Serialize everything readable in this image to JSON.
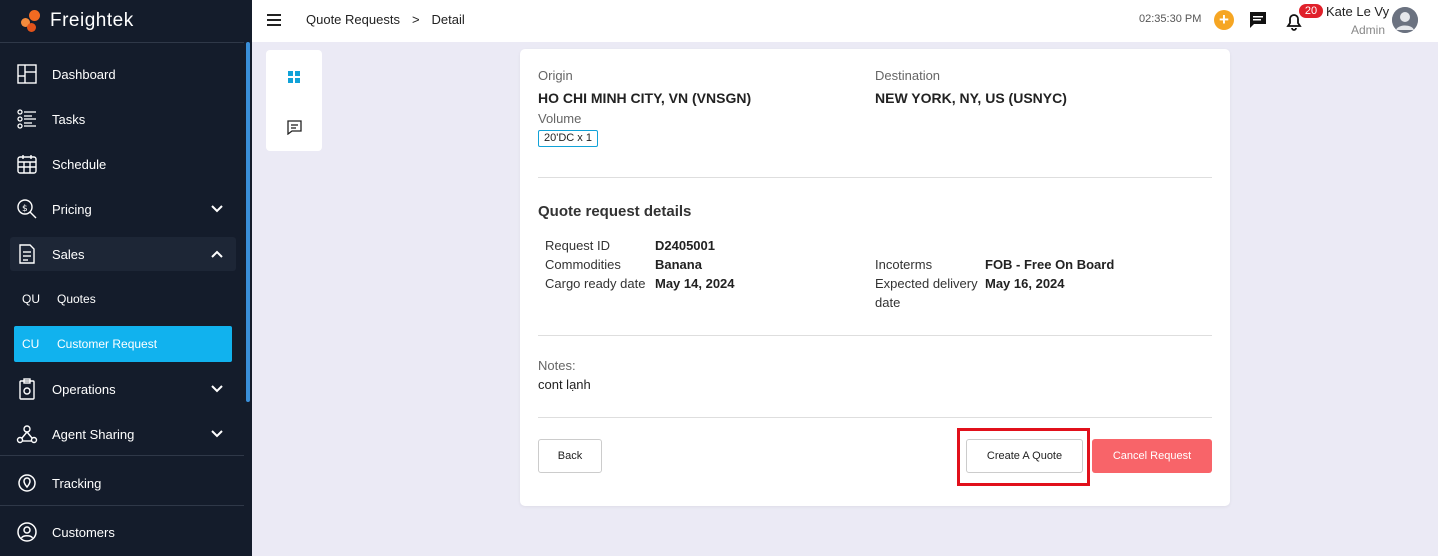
{
  "brand": {
    "name": "Freightek",
    "color": "#f26a21"
  },
  "sidebar": {
    "items": [
      {
        "label": "Dashboard",
        "icon": "dashboard-icon"
      },
      {
        "label": "Tasks",
        "icon": "tasks-icon"
      },
      {
        "label": "Schedule",
        "icon": "schedule-icon"
      },
      {
        "label": "Pricing",
        "icon": "pricing-icon",
        "expandable": true
      },
      {
        "label": "Sales",
        "icon": "sales-icon",
        "expanded": true
      },
      {
        "label": "Operations",
        "icon": "operations-icon",
        "expandable": true
      },
      {
        "label": "Agent Sharing",
        "icon": "agent-sharing-icon",
        "expandable": true
      },
      {
        "label": "Tracking",
        "icon": "tracking-icon"
      },
      {
        "label": "Customers",
        "icon": "customers-icon"
      }
    ],
    "sales_sub": [
      {
        "abbr": "QU",
        "label": "Quotes"
      },
      {
        "abbr": "CU",
        "label": "Customer Request",
        "selected": true
      }
    ],
    "accent": "#11b2ee"
  },
  "topbar": {
    "breadcrumb": [
      "Quote Requests",
      ">",
      "Detail"
    ],
    "clock": "02:35:30 PM",
    "notification_count": "20",
    "user_name": "Kate Le Vy",
    "user_role": "Admin"
  },
  "route": {
    "origin_label": "Origin",
    "origin_value": "HO CHI MINH CITY, VN (VNSGN)",
    "destination_label": "Destination",
    "destination_value": "NEW YORK, NY, US (USNYC)",
    "volume_label": "Volume",
    "volume_tag": "20'DC x 1"
  },
  "details": {
    "title": "Quote request details",
    "request_id_label": "Request ID",
    "request_id_value": "D2405001",
    "commodities_label": "Commodities",
    "commodities_value": "Banana",
    "cargo_ready_label": "Cargo ready date",
    "cargo_ready_value": "May 14, 2024",
    "incoterms_label": "Incoterms",
    "incoterms_value": "FOB - Free On Board",
    "expected_delivery_label_1": "Expected delivery",
    "expected_delivery_label_2": "date",
    "expected_delivery_value": "May 16, 2024"
  },
  "notes": {
    "label": "Notes:",
    "value": "cont lạnh"
  },
  "actions": {
    "back": "Back",
    "create": "Create A Quote",
    "cancel": "Cancel Request",
    "cancel_color": "#f86469",
    "highlight_color": "#e1101b"
  }
}
